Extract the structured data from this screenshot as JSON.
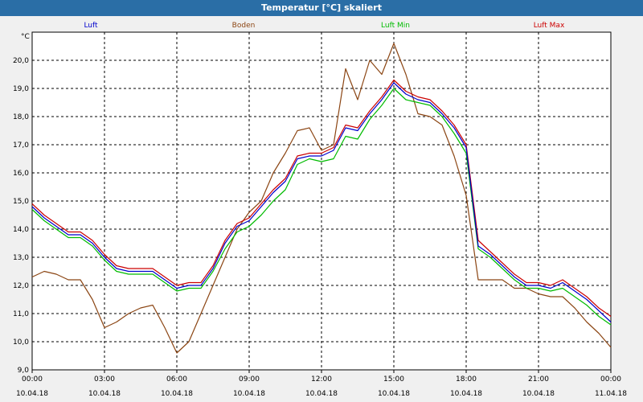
{
  "window": {
    "title": "Temperatur [°C] skaliert"
  },
  "colors": {
    "titlebar": "#2a6ea6",
    "Luft": "#0000cc",
    "Boden": "#8b4513",
    "Luft Min": "#00bb00",
    "Luft Max": "#cc0000"
  },
  "chart_data": {
    "type": "line",
    "title": "Temperatur [°C] skaliert",
    "unit": "°C",
    "ylim": [
      9.0,
      21.0
    ],
    "y_ticks": [
      "9,0",
      "10,0",
      "11,0",
      "12,0",
      "13,0",
      "14,0",
      "15,0",
      "16,0",
      "17,0",
      "18,0",
      "19,0",
      "20,0"
    ],
    "x_range_hours": [
      0,
      24
    ],
    "x_ticks": [
      {
        "time": "00:00",
        "date": "10.04.18"
      },
      {
        "time": "03:00",
        "date": "10.04.18"
      },
      {
        "time": "06:00",
        "date": "10.04.18"
      },
      {
        "time": "09:00",
        "date": "10.04.18"
      },
      {
        "time": "12:00",
        "date": "10.04.18"
      },
      {
        "time": "15:00",
        "date": "10.04.18"
      },
      {
        "time": "18:00",
        "date": "10.04.18"
      },
      {
        "time": "21:00",
        "date": "10.04.18"
      },
      {
        "time": "00:00",
        "date": "11.04.18"
      }
    ],
    "grid": true,
    "legend_position": "top",
    "series": [
      {
        "name": "Luft",
        "x": [
          0,
          0.5,
          1,
          1.5,
          2,
          2.5,
          3,
          3.5,
          4,
          4.5,
          5,
          5.5,
          6,
          6.5,
          7,
          7.5,
          8,
          8.5,
          9,
          9.5,
          10,
          10.5,
          11,
          11.5,
          12,
          12.5,
          13,
          13.5,
          14,
          14.5,
          15,
          15.5,
          16,
          16.5,
          17,
          17.5,
          18,
          18.5,
          19,
          19.5,
          20,
          20.5,
          21,
          21.5,
          22,
          22.5,
          23,
          23.5,
          24
        ],
        "values": [
          14.8,
          14.4,
          14.1,
          13.8,
          13.8,
          13.5,
          13.0,
          12.6,
          12.5,
          12.5,
          12.5,
          12.2,
          11.9,
          12.0,
          12.0,
          12.6,
          13.5,
          14.1,
          14.3,
          14.8,
          15.3,
          15.7,
          16.5,
          16.6,
          16.6,
          16.8,
          17.6,
          17.5,
          18.1,
          18.6,
          19.2,
          18.8,
          18.6,
          18.5,
          18.1,
          17.6,
          16.9,
          13.4,
          13.1,
          12.7,
          12.3,
          12.0,
          12.0,
          11.9,
          12.1,
          11.8,
          11.5,
          11.1,
          10.7
        ]
      },
      {
        "name": "Boden",
        "x": [
          0,
          0.5,
          1,
          1.5,
          2,
          2.5,
          3,
          3.5,
          4,
          4.5,
          5,
          5.5,
          6,
          6.5,
          7,
          7.5,
          8,
          8.5,
          9,
          9.5,
          10,
          10.5,
          11,
          11.5,
          12,
          12.5,
          13,
          13.5,
          14,
          14.5,
          15,
          15.5,
          16,
          16.5,
          17,
          17.5,
          18,
          18.5,
          19,
          19.5,
          20,
          20.5,
          21,
          21.5,
          22,
          22.5,
          23,
          23.5,
          24
        ],
        "values": [
          12.3,
          12.5,
          12.4,
          12.2,
          12.2,
          11.5,
          10.5,
          10.7,
          11.0,
          11.2,
          11.3,
          10.5,
          9.6,
          10.0,
          11.0,
          12.0,
          13.0,
          14.0,
          14.6,
          15.0,
          16.0,
          16.7,
          17.5,
          17.6,
          16.8,
          17.0,
          19.7,
          18.6,
          20.0,
          19.5,
          20.6,
          19.5,
          18.1,
          18.0,
          17.7,
          16.6,
          15.2,
          12.2,
          12.2,
          12.2,
          11.9,
          11.9,
          11.7,
          11.6,
          11.6,
          11.2,
          10.7,
          10.3,
          9.8
        ]
      },
      {
        "name": "Luft Min",
        "x": [
          0,
          0.5,
          1,
          1.5,
          2,
          2.5,
          3,
          3.5,
          4,
          4.5,
          5,
          5.5,
          6,
          6.5,
          7,
          7.5,
          8,
          8.5,
          9,
          9.5,
          10,
          10.5,
          11,
          11.5,
          12,
          12.5,
          13,
          13.5,
          14,
          14.5,
          15,
          15.5,
          16,
          16.5,
          17,
          17.5,
          18,
          18.5,
          19,
          19.5,
          20,
          20.5,
          21,
          21.5,
          22,
          22.5,
          23,
          23.5,
          24
        ],
        "values": [
          14.7,
          14.3,
          14.0,
          13.7,
          13.7,
          13.4,
          12.9,
          12.5,
          12.4,
          12.4,
          12.4,
          12.1,
          11.8,
          11.9,
          11.9,
          12.5,
          13.3,
          13.9,
          14.1,
          14.5,
          15.0,
          15.4,
          16.3,
          16.5,
          16.4,
          16.5,
          17.3,
          17.2,
          17.9,
          18.4,
          19.0,
          18.6,
          18.5,
          18.4,
          18.0,
          17.4,
          16.7,
          13.3,
          13.0,
          12.6,
          12.2,
          11.9,
          11.9,
          11.8,
          11.9,
          11.6,
          11.3,
          10.9,
          10.6
        ]
      },
      {
        "name": "Luft Max",
        "x": [
          0,
          0.5,
          1,
          1.5,
          2,
          2.5,
          3,
          3.5,
          4,
          4.5,
          5,
          5.5,
          6,
          6.5,
          7,
          7.5,
          8,
          8.5,
          9,
          9.5,
          10,
          10.5,
          11,
          11.5,
          12,
          12.5,
          13,
          13.5,
          14,
          14.5,
          15,
          15.5,
          16,
          16.5,
          17,
          17.5,
          18,
          18.5,
          19,
          19.5,
          20,
          20.5,
          21,
          21.5,
          22,
          22.5,
          23,
          23.5,
          24
        ],
        "values": [
          14.9,
          14.5,
          14.2,
          13.9,
          13.9,
          13.6,
          13.1,
          12.7,
          12.6,
          12.6,
          12.6,
          12.3,
          12.0,
          12.1,
          12.1,
          12.7,
          13.6,
          14.2,
          14.4,
          14.9,
          15.4,
          15.8,
          16.6,
          16.7,
          16.7,
          16.9,
          17.7,
          17.6,
          18.2,
          18.7,
          19.3,
          18.9,
          18.7,
          18.6,
          18.2,
          17.7,
          17.0,
          13.6,
          13.2,
          12.8,
          12.4,
          12.1,
          12.1,
          12.0,
          12.2,
          11.9,
          11.6,
          11.2,
          10.9
        ]
      }
    ]
  }
}
